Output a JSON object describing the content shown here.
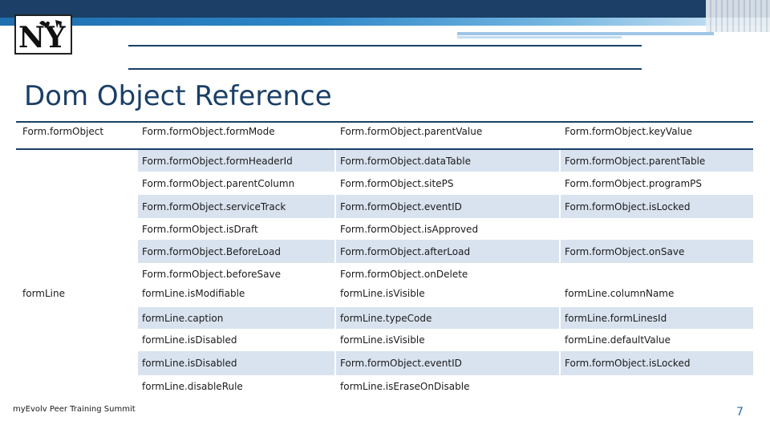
{
  "slide": {
    "logo_text": "NY",
    "title": "Dom Object Reference",
    "footer": "myEvolv Peer Training Summit",
    "page_number": "7",
    "accent_color": "#1b3f66",
    "shade_color": "#d9e3ef"
  },
  "table": {
    "rows": [
      [
        "Form.formObject",
        "Form.formObject.formMode",
        "Form.formObject.parentValue",
        "Form.formObject.keyValue"
      ],
      [
        "",
        "Form.formObject.formHeaderId",
        "Form.formObject.dataTable",
        "Form.formObject.parentTable"
      ],
      [
        "",
        "Form.formObject.parentColumn",
        "Form.formObject.sitePS",
        "Form.formObject.programPS"
      ],
      [
        "",
        "Form.formObject.serviceTrack",
        "Form.formObject.eventID",
        "Form.formObject.isLocked"
      ],
      [
        "",
        "Form.formObject.isDraft",
        "Form.formObject.isApproved",
        ""
      ],
      [
        "",
        "Form.formObject.BeforeLoad",
        "Form.formObject.afterLoad",
        "Form.formObject.onSave"
      ],
      [
        "",
        "Form.formObject.beforeSave",
        "Form.formObject.onDelete",
        ""
      ],
      [
        "formLine",
        "formLine.isModifiable",
        "formLine.isVisible",
        "formLine.columnName"
      ],
      [
        "",
        "formLine.caption",
        "formLine.typeCode",
        "formLine.formLinesId"
      ],
      [
        "",
        "formLine.isDisabled",
        "formLine.isVisible",
        "formLine.defaultValue"
      ],
      [
        "",
        "formLine.isDisabled",
        "Form.formObject.eventID",
        "Form.formObject.isLocked"
      ],
      [
        "",
        "formLine.disableRule",
        "formLine.isEraseOnDisable",
        ""
      ]
    ]
  }
}
